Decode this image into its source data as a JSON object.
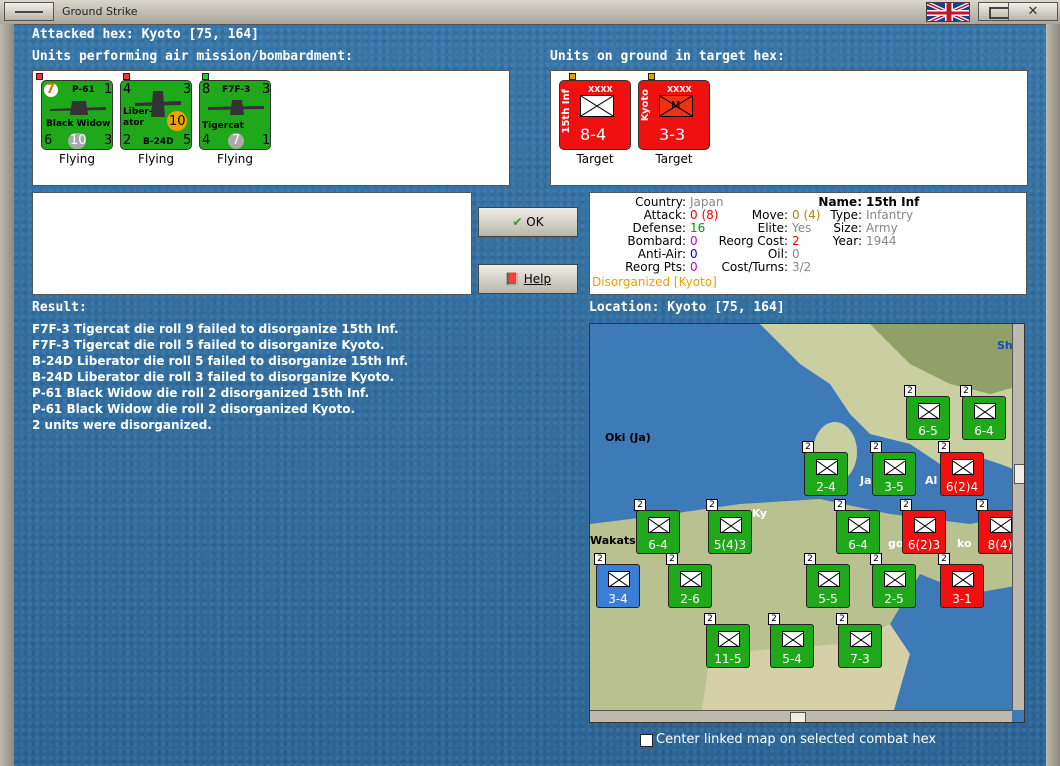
{
  "window": {
    "title": "Ground Strike"
  },
  "header": {
    "attacked_hex": "Attacked hex: Kyoto  [75, 164]"
  },
  "air_units": {
    "heading": "Units performing air mission/bombardment:",
    "items": [
      {
        "name": "P-61",
        "line2": "Black Widow",
        "top_left": "7",
        "top_right": "1",
        "bottom_left": "6",
        "center": "10",
        "bottom_right": "3",
        "status": "Flying"
      },
      {
        "name": "Liber-",
        "line2": "ator",
        "line3": "B-24D",
        "top_left": "4",
        "top_right": "3",
        "bottom_left": "2",
        "center": "10",
        "bottom_right": "5",
        "status": "Flying"
      },
      {
        "name": "F7F-3",
        "line2": "Tigercat",
        "top_left": "8",
        "top_right": "3",
        "bottom_left": "4",
        "center": "7",
        "bottom_right": "1",
        "status": "Flying"
      }
    ]
  },
  "ground_units": {
    "heading": "Units on ground in target hex:",
    "items": [
      {
        "name": "15th Inf",
        "size": "XXXX",
        "strength": "8-4",
        "status": "Target"
      },
      {
        "name": "Kyoto",
        "size": "XXXX",
        "symbol": "M",
        "strength": "3-3",
        "status": "Target"
      }
    ]
  },
  "buttons": {
    "ok": "OK",
    "help": "Help"
  },
  "unit_info": {
    "country_label": "Country:",
    "country": "Japan",
    "attack_label": "Attack:",
    "attack": "0 (8)",
    "defense_label": "Defense:",
    "defense": "16",
    "bombard_label": "Bombard:",
    "bombard": "0",
    "antiair_label": "Anti-Air:",
    "antiair": "0",
    "reorg_label": "Reorg Pts:",
    "reorg": "0",
    "move_label": "Move:",
    "move": "0 (4)",
    "elite_label": "Elite:",
    "elite": "Yes",
    "reorgcost_label": "Reorg Cost:",
    "reorgcost": "2",
    "oil_label": "Oil:",
    "oil": "0",
    "costturns_label": "Cost/Turns:",
    "costturns": "3/2",
    "name_label": "Name:",
    "name": "15th Inf",
    "type_label": "Type:",
    "type": "Infantry",
    "size_label": "Size:",
    "size": "Army",
    "year_label": "Year:",
    "year": "1944",
    "status": "Disorganized [Kyoto]"
  },
  "result": {
    "heading": "Result:",
    "lines": [
      "F7F-3 Tigercat die roll 9 failed to disorganize 15th Inf.",
      "F7F-3 Tigercat die roll 5 failed to disorganize Kyoto.",
      "B-24D Liberator die roll 5 failed to disorganize 15th Inf.",
      "B-24D Liberator die roll 3 failed to disorganize Kyoto.",
      "P-61 Black Widow die roll 2 disorganized 15th Inf.",
      "P-61 Black Widow die roll 2 disorganized Kyoto.",
      "2 units were disorganized."
    ]
  },
  "location": {
    "heading": "Location:  Kyoto  [75, 164]"
  },
  "map": {
    "labels": [
      "Oki (Ja)",
      "Wakats",
      "Ja",
      "Al",
      "Ky",
      "go",
      "ko",
      "Sh"
    ],
    "counters": [
      {
        "v": "6-5",
        "c": "green"
      },
      {
        "v": "6-4",
        "c": "green"
      },
      {
        "v": "2-4",
        "c": "green"
      },
      {
        "v": "3-5",
        "c": "green"
      },
      {
        "v": "6(2)4",
        "c": "red"
      },
      {
        "v": "6-4",
        "c": "green"
      },
      {
        "v": "5(4)3",
        "c": "green"
      },
      {
        "v": "6-4",
        "c": "green"
      },
      {
        "v": "6(2)3",
        "c": "red"
      },
      {
        "v": "8(4)",
        "c": "red"
      },
      {
        "v": "3-4",
        "c": "blue"
      },
      {
        "v": "2-6",
        "c": "green"
      },
      {
        "v": "5-5",
        "c": "green"
      },
      {
        "v": "2-5",
        "c": "green"
      },
      {
        "v": "3-1",
        "c": "red"
      },
      {
        "v": "11-5",
        "c": "green"
      },
      {
        "v": "5-4",
        "c": "green"
      },
      {
        "v": "7-3",
        "c": "green"
      }
    ]
  },
  "checkbox": {
    "label": "Center linked map on selected combat hex",
    "checked": false
  }
}
